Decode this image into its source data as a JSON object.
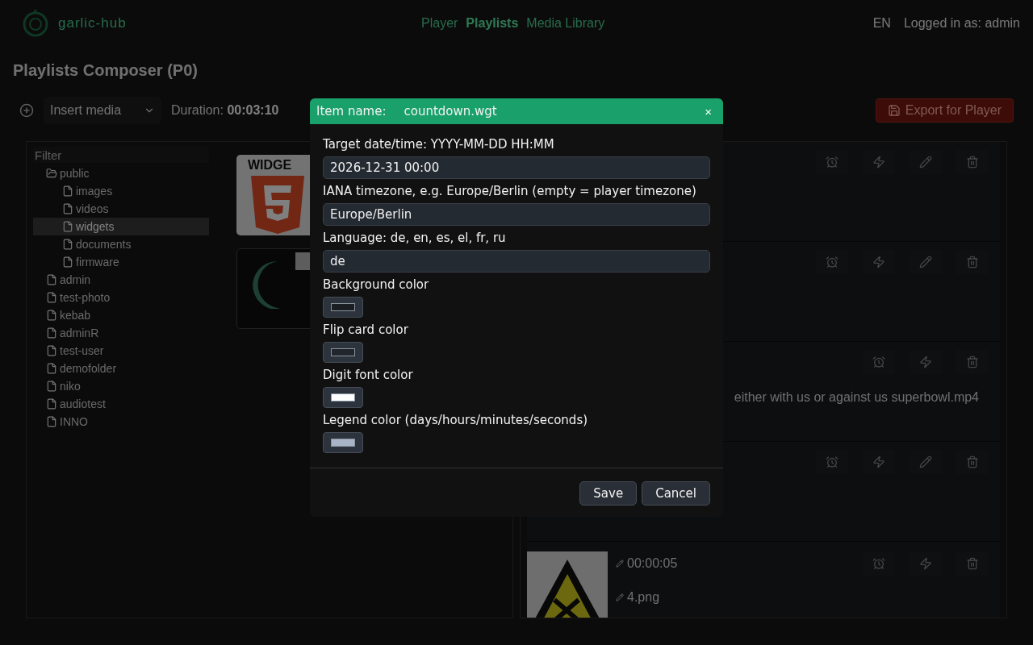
{
  "header": {
    "logo_text": "garlic-hub",
    "nav": [
      {
        "label": "Player",
        "selected": false
      },
      {
        "label": "Playlists",
        "selected": true
      },
      {
        "label": "Media Library",
        "selected": false
      }
    ],
    "language": "EN",
    "user": "Logged in as: admin"
  },
  "page_title": "Playlists Composer (P0)",
  "toolbar": {
    "insert_select": "Insert media",
    "duration_label": "Duration:",
    "duration_value": "00:03:10",
    "export_button": "Export for Player"
  },
  "media_tree": {
    "filter_placeholder": "Filter",
    "items": [
      {
        "label": "public",
        "kind": "folder",
        "expanded": true,
        "selected": false,
        "children": [
          {
            "label": "images",
            "kind": "file",
            "selected": false
          },
          {
            "label": "videos",
            "kind": "file",
            "selected": false
          },
          {
            "label": "widgets",
            "kind": "file",
            "selected": true
          },
          {
            "label": "documents",
            "kind": "file",
            "selected": false
          },
          {
            "label": "firmware",
            "kind": "file",
            "selected": false
          }
        ]
      },
      {
        "label": "admin",
        "kind": "file",
        "selected": false
      },
      {
        "label": "test-photo",
        "kind": "file",
        "selected": false
      },
      {
        "label": "kebab",
        "kind": "file",
        "selected": false
      },
      {
        "label": "adminR",
        "kind": "file",
        "selected": false
      },
      {
        "label": "test-user",
        "kind": "file",
        "selected": false
      },
      {
        "label": "demofolder",
        "kind": "file",
        "selected": false
      },
      {
        "label": "niko",
        "kind": "file",
        "selected": false
      },
      {
        "label": "audiotest",
        "kind": "file",
        "selected": false
      },
      {
        "label": "INNO",
        "kind": "file",
        "selected": false
      }
    ]
  },
  "media_thumbnails": [
    {
      "kind": "html5",
      "caption": "WIDGE"
    },
    {
      "kind": "moon",
      "checked": false
    }
  ],
  "playlist_items": [
    {
      "editable": true
    },
    {
      "editable": true
    },
    {
      "editable": false,
      "title": "either with us or against us superbowl.mp4"
    },
    {
      "editable": true
    },
    {
      "editable": false,
      "duration": "00:00:05",
      "name": "4.png"
    }
  ],
  "dialog": {
    "header_label": "Item name:",
    "item_name": "countdown.wgt",
    "close": "×",
    "fields": [
      {
        "kind": "text",
        "label": "Target date/time: YYYY-MM-DD HH:MM",
        "value": "2026-12-31 00:00"
      },
      {
        "kind": "text",
        "label": "IANA timezone, e.g. Europe/Berlin (empty = player timezone)",
        "value": "Europe/Berlin"
      },
      {
        "kind": "text",
        "label": "Language: de, en, es, el, fr, ru",
        "value": "de"
      },
      {
        "kind": "color",
        "label": "Background color",
        "color": "#1a1d21"
      },
      {
        "kind": "color",
        "label": "Flip card color",
        "color": "#22262c"
      },
      {
        "kind": "color",
        "label": "Digit font color",
        "color": "#ffffff"
      },
      {
        "kind": "color",
        "label": "Legend color (days/hours/minutes/seconds)",
        "color": "#a9b4c8"
      }
    ],
    "buttons": [
      "Save",
      "Cancel"
    ]
  }
}
